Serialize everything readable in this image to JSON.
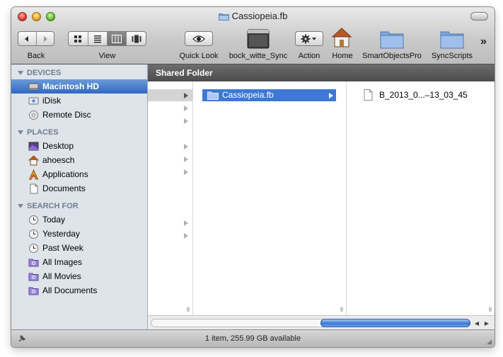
{
  "window": {
    "title": "Cassiopeia.fb",
    "status_text": "1 item, 255.99 GB available"
  },
  "toolbar": {
    "back_label": "Back",
    "view_label": "View",
    "quicklook_label": "Quick Look",
    "bock_label": "bock_witte_Sync",
    "action_label": "Action",
    "home_label": "Home",
    "smartobjects_label": "SmartObjectsPro",
    "syncscripts_label": "SyncScripts",
    "overflow": "»"
  },
  "sidebar": {
    "devices_header": "DEVICES",
    "places_header": "PLACES",
    "search_header": "SEARCH FOR",
    "devices": [
      {
        "label": "Macintosh HD",
        "icon": "hard-drive-icon"
      },
      {
        "label": "iDisk",
        "icon": "idisk-icon"
      },
      {
        "label": "Remote Disc",
        "icon": "disc-icon"
      }
    ],
    "places": [
      {
        "label": "Desktop",
        "icon": "desktop-icon"
      },
      {
        "label": "ahoesch",
        "icon": "home-icon"
      },
      {
        "label": "Applications",
        "icon": "applications-icon"
      },
      {
        "label": "Documents",
        "icon": "document-icon"
      }
    ],
    "searches": [
      {
        "label": "Today",
        "icon": "clock-icon"
      },
      {
        "label": "Yesterday",
        "icon": "clock-icon"
      },
      {
        "label": "Past Week",
        "icon": "clock-icon"
      },
      {
        "label": "All Images",
        "icon": "smart-folder-icon"
      },
      {
        "label": "All Movies",
        "icon": "smart-folder-icon"
      },
      {
        "label": "All Documents",
        "icon": "smart-folder-icon"
      }
    ]
  },
  "browser": {
    "header": "Shared Folder",
    "column2_item": "Cassiopeia.fb",
    "column3_item": "B_2013_0...–13_03_45"
  },
  "colors": {
    "selection": "#3d79d4",
    "sidebar_bg": "#dee4ea",
    "path_header_bg": "#5a5a5a"
  }
}
